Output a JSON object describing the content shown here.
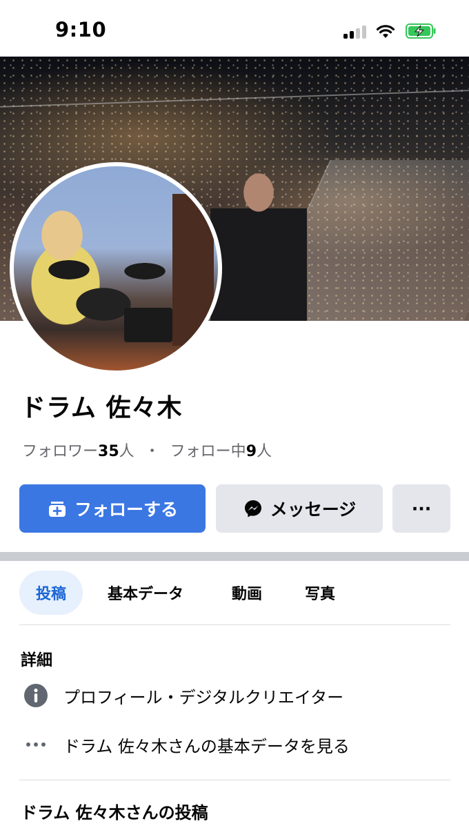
{
  "status_bar": {
    "time": "9:10"
  },
  "profile": {
    "name": "ドラム 佐々木",
    "followers_label": "フォロワー",
    "followers_count": "35",
    "people_suffix": "人",
    "separator": "・",
    "following_label": "フォロー中",
    "following_count": "9"
  },
  "actions": {
    "follow_label": "フォローする",
    "message_label": "メッセージ",
    "more_label": "···"
  },
  "tabs": [
    {
      "label": "投稿",
      "active": true
    },
    {
      "label": "基本データ",
      "active": false
    },
    {
      "label": "動画",
      "active": false
    },
    {
      "label": "写真",
      "active": false
    }
  ],
  "details": {
    "title": "詳細",
    "items": [
      {
        "icon": "info-icon",
        "text": "プロフィール・デジタルクリエイター"
      },
      {
        "icon": "more-dots-icon",
        "text": "ドラム 佐々木さんの基本データを見る"
      }
    ]
  },
  "posts": {
    "title": "ドラム 佐々木さんの投稿"
  },
  "colors": {
    "primary": "#3b77e3",
    "secondary_button": "#e4e6eb",
    "active_tab_bg": "#e7f0fd",
    "active_tab_text": "#1b66d6",
    "muted_text": "#65676b",
    "battery_green": "#34c759"
  },
  "icons": [
    "signal-icon",
    "wifi-icon",
    "battery-charging-icon",
    "follow-add-icon",
    "messenger-icon",
    "info-icon",
    "more-dots-icon"
  ]
}
